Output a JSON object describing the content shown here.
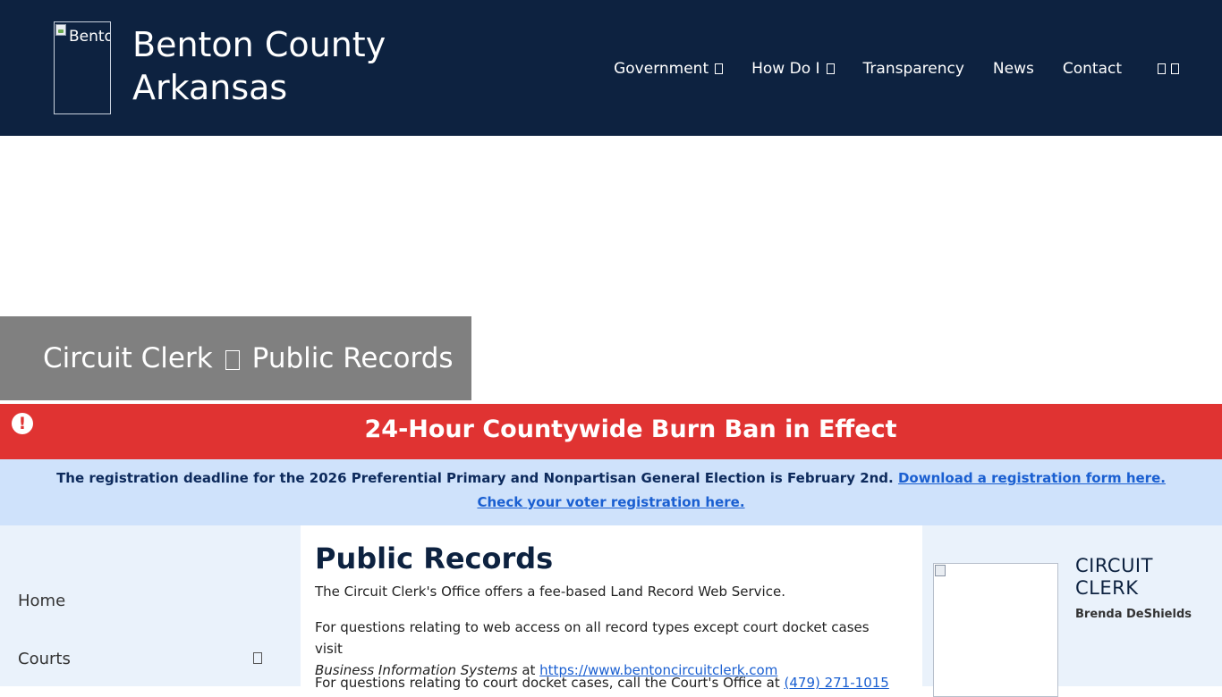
{
  "header": {
    "logo_alt": "Benton County Arkansas",
    "site_title": "Benton County Arkansas",
    "nav": [
      {
        "label": "Government"
      },
      {
        "label": "How Do I"
      },
      {
        "label": "Transparency"
      },
      {
        "label": "News"
      },
      {
        "label": "Contact"
      }
    ]
  },
  "breadcrumb": {
    "parent": "Circuit Clerk",
    "current": "Public Records"
  },
  "alert": {
    "icon": "exclamation-circle-icon",
    "title": "24-Hour Countywide Burn Ban in Effect",
    "color": "#e03332"
  },
  "info_banner": {
    "text": "The registration deadline for the 2026 Preferential Primary and Nonpartisan General Election is February 2nd.",
    "link1": "Download a registration form here.",
    "link2": "Check your voter registration here. "
  },
  "sidebar": {
    "items": [
      {
        "label": "Home"
      },
      {
        "label": "Courts"
      }
    ]
  },
  "main": {
    "heading": "Public Records",
    "p1": "The Circuit Clerk's Office offers a fee-based Land Record Web Service.",
    "p2_text": "For questions relating to web access on all record types except court docket cases visit",
    "p2_italic": "Business Information Systems",
    "p2_at": "at",
    "p2_link": "https://www.bentoncircuitclerk.com",
    "p3_text": "For questions relating to court docket cases, call the Court's Office at",
    "p3_link": "(479) 271-1015"
  },
  "officer": {
    "title": "CIRCUIT CLERK",
    "name": "Brenda DeShields"
  },
  "colors": {
    "header_bg": "#0d2240",
    "crumb_bg": "#808080",
    "info_bg": "#cfe2fb",
    "link": "#1a5fd1"
  }
}
